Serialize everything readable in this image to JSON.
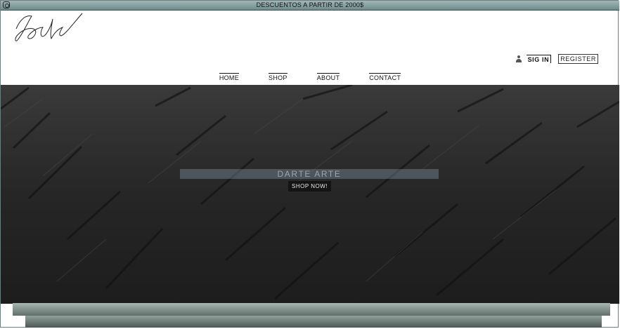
{
  "topbar": {
    "announcement": "DESCUENTOS A PARTIR DE 2000$",
    "icon": "instagram-icon"
  },
  "header": {
    "logo": "signature-logo",
    "sign_in": "SIG IN",
    "register": "REGISTER"
  },
  "nav": {
    "items": [
      "HOME",
      "SHOP",
      "ABOUT",
      "CONTACT"
    ]
  },
  "hero": {
    "title": "DARTE ARTE",
    "button": "SHOP NOW!"
  },
  "colors": {
    "topbar": "#7f9a9b",
    "hero_bg": "#2a2a2a",
    "button_bg": "#141414"
  }
}
